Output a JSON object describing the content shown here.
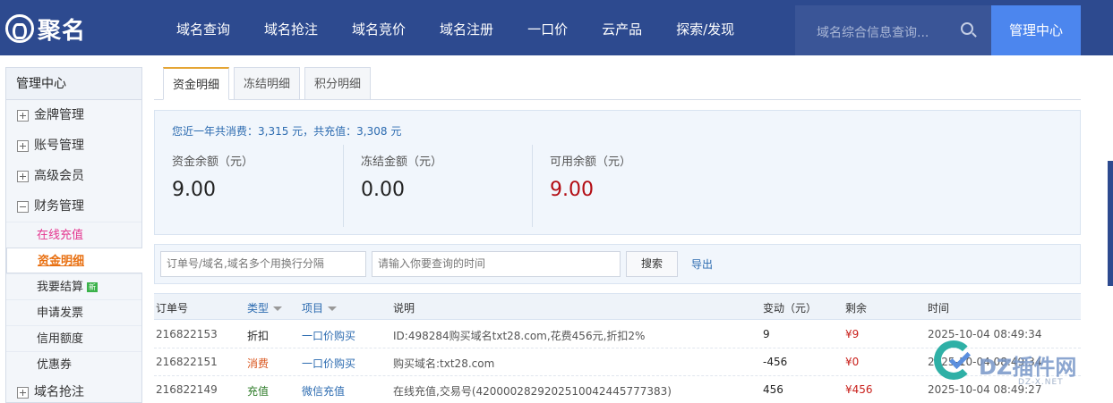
{
  "logo": {
    "text": "聚名"
  },
  "nav": [
    "域名查询",
    "域名抢注",
    "域名竞价",
    "域名注册",
    "一口价",
    "云产品",
    "探索/发现"
  ],
  "search": {
    "placeholder": "域名综合信息查询..."
  },
  "admin_button": "管理中心",
  "sidebar": {
    "title": "管理中心",
    "groups": [
      {
        "label": "金牌管理",
        "state": "collapsed"
      },
      {
        "label": "账号管理",
        "state": "collapsed"
      },
      {
        "label": "高级会员",
        "state": "collapsed"
      },
      {
        "label": "财务管理",
        "state": "expanded"
      }
    ],
    "finance_items": [
      "在线充值",
      "资金明细",
      "我要结算",
      "申请发票",
      "信用额度",
      "优惠券"
    ],
    "new_badge": "新",
    "last_group": "域名抢注"
  },
  "tabs": [
    "资金明细",
    "冻结明细",
    "积分明细"
  ],
  "summary": {
    "note": "您近一年共消费：3,315 元，共充值：3,308 元",
    "balance_label": "资金余额（元）",
    "balance_value": "9.00",
    "frozen_label": "冻结金额（元）",
    "frozen_value": "0.00",
    "available_label": "可用余额（元）",
    "available_value": "9.00"
  },
  "filter": {
    "order_placeholder": "订单号/域名,域名多个用换行分隔",
    "time_placeholder": "请输入你要查询的时间",
    "search_button": "搜索",
    "export_link": "导出"
  },
  "table": {
    "headers": {
      "order": "订单号",
      "type": "类型",
      "item": "项目",
      "desc": "说明",
      "change": "变动（元）",
      "remain": "剩余",
      "time": "时间"
    },
    "rows": [
      {
        "order": "216822153",
        "type": "折扣",
        "item": "一口价购买",
        "desc": "ID:498284购买域名txt28.com,花费456元,折扣2%",
        "change": "9",
        "remain": "¥9",
        "time": "2025-10-04 08:49:34"
      },
      {
        "order": "216822151",
        "type": "消费",
        "item": "一口价购买",
        "desc": "购买域名:txt28.com",
        "change": "-456",
        "remain": "¥0",
        "time": "2025-10-04 08:49:34"
      },
      {
        "order": "216822149",
        "type": "充值",
        "item": "微信充值",
        "desc": "在线充值,交易号(4200002829202510042445777383)",
        "change": "456",
        "remain": "¥456",
        "time": "2025-10-04 08:49:27"
      }
    ]
  },
  "watermark": {
    "text": "DZ插件网",
    "sub": "DZ-X.NET"
  },
  "colors": {
    "topbar": "#2d4a8f",
    "admin_button": "#4c86ee",
    "link_blue": "#2c6bb0",
    "active_orange": "#e86f10",
    "recharge_pink": "#e4368f",
    "amount_red": "#b30d14"
  }
}
